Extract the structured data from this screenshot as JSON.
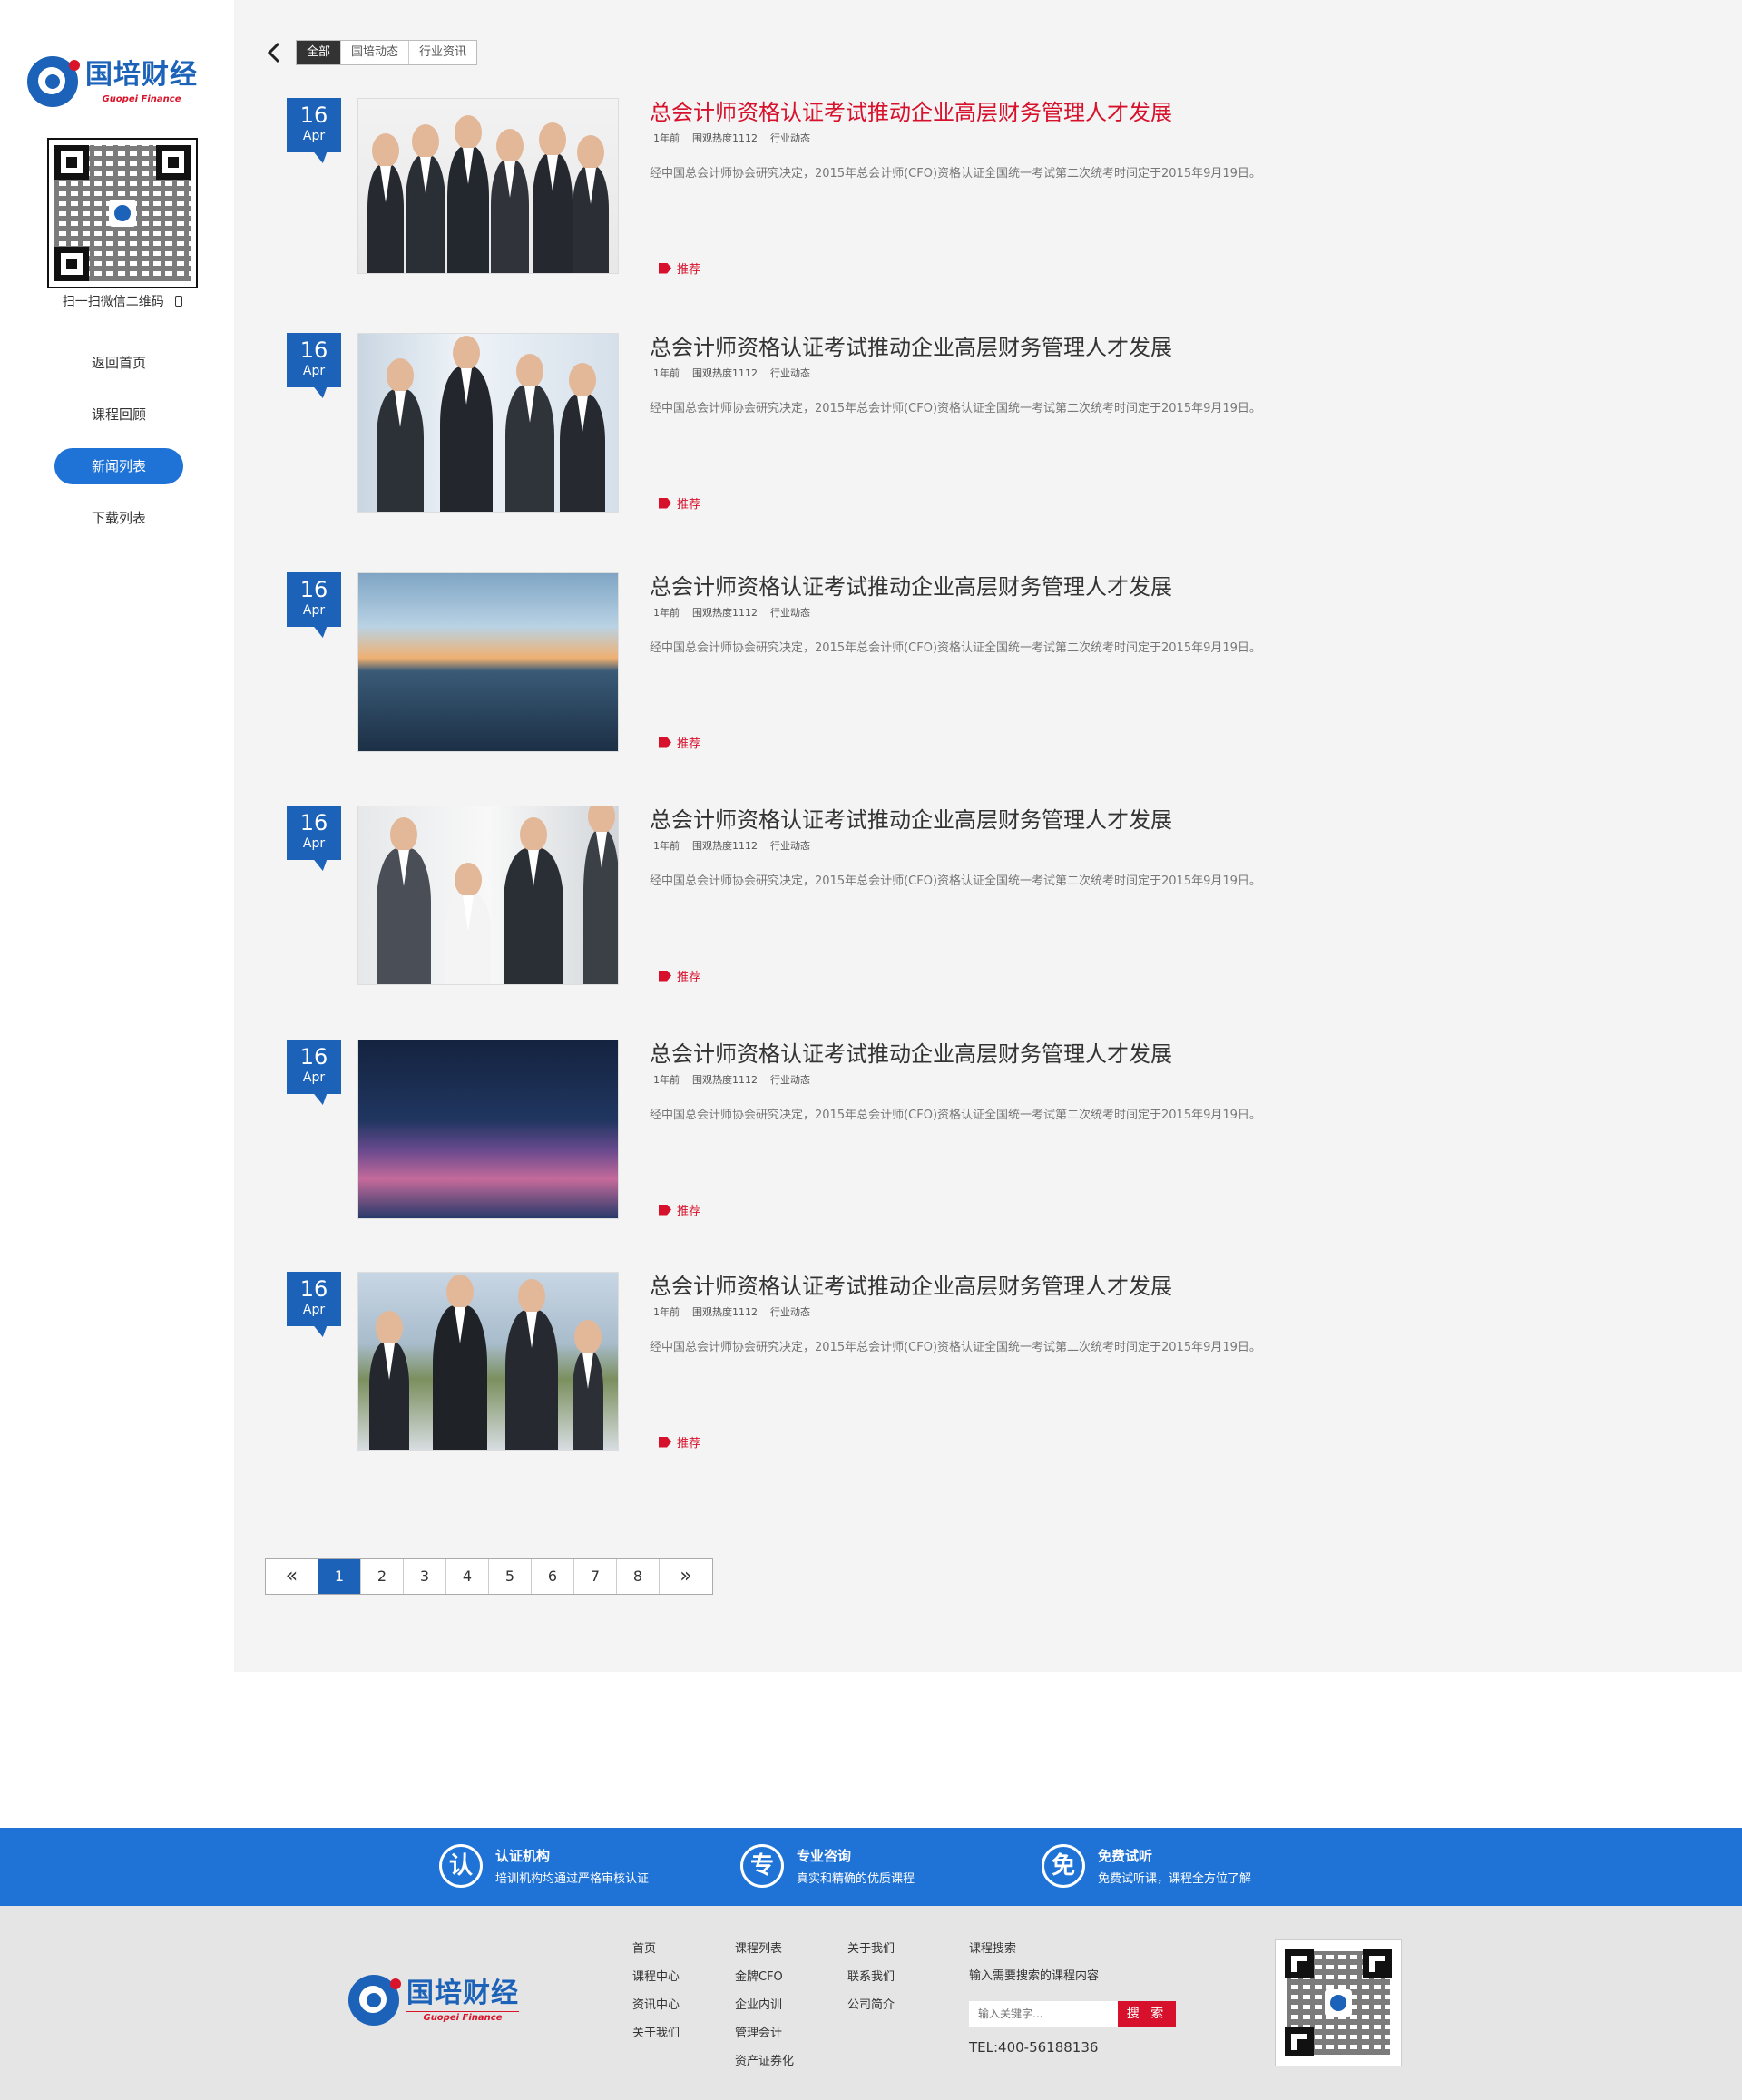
{
  "brand": {
    "name_cn": "国培财经",
    "name_en": "Guopei Finance"
  },
  "sidebar": {
    "qr_caption": "扫一扫微信二维码",
    "items": [
      {
        "label": "返回首页"
      },
      {
        "label": "课程回顾"
      },
      {
        "label": "新闻列表",
        "active": true
      },
      {
        "label": "下载列表"
      }
    ]
  },
  "filter": {
    "tabs": [
      "全部",
      "国培动态",
      "行业资讯"
    ],
    "active": "全部"
  },
  "articles": [
    {
      "day": "16",
      "month": "Apr",
      "title": "总会计师资格认证考试推动企业高层财务管理人才发展",
      "time": "1年前",
      "heat": "围观热度1112",
      "category": "行业动态",
      "desc": "经中国总会计师协会研究决定，2015年总会计师(CFO)资格认证全国统一考试第二次统考时间定于2015年9月19日。",
      "tag": "推荐"
    },
    {
      "day": "16",
      "month": "Apr",
      "title": "总会计师资格认证考试推动企业高层财务管理人才发展",
      "time": "1年前",
      "heat": "围观热度1112",
      "category": "行业动态",
      "desc": "经中国总会计师协会研究决定，2015年总会计师(CFO)资格认证全国统一考试第二次统考时间定于2015年9月19日。",
      "tag": "推荐"
    },
    {
      "day": "16",
      "month": "Apr",
      "title": "总会计师资格认证考试推动企业高层财务管理人才发展",
      "time": "1年前",
      "heat": "围观热度1112",
      "category": "行业动态",
      "desc": "经中国总会计师协会研究决定，2015年总会计师(CFO)资格认证全国统一考试第二次统考时间定于2015年9月19日。",
      "tag": "推荐"
    },
    {
      "day": "16",
      "month": "Apr",
      "title": "总会计师资格认证考试推动企业高层财务管理人才发展",
      "time": "1年前",
      "heat": "围观热度1112",
      "category": "行业动态",
      "desc": "经中国总会计师协会研究决定，2015年总会计师(CFO)资格认证全国统一考试第二次统考时间定于2015年9月19日。",
      "tag": "推荐"
    },
    {
      "day": "16",
      "month": "Apr",
      "title": "总会计师资格认证考试推动企业高层财务管理人才发展",
      "time": "1年前",
      "heat": "围观热度1112",
      "category": "行业动态",
      "desc": "经中国总会计师协会研究决定，2015年总会计师(CFO)资格认证全国统一考试第二次统考时间定于2015年9月19日。",
      "tag": "推荐"
    },
    {
      "day": "16",
      "month": "Apr",
      "title": "总会计师资格认证考试推动企业高层财务管理人才发展",
      "time": "1年前",
      "heat": "围观热度1112",
      "category": "行业动态",
      "desc": "经中国总会计师协会研究决定，2015年总会计师(CFO)资格认证全国统一考试第二次统考时间定于2015年9月19日。",
      "tag": "推荐"
    }
  ],
  "pagination": {
    "prev": "«",
    "pages": [
      "1",
      "2",
      "3",
      "4",
      "5",
      "6",
      "7",
      "8"
    ],
    "current": "1",
    "next": "»"
  },
  "features": [
    {
      "icon": "认",
      "title": "认证机构",
      "sub": "培训机构均通过严格审核认证"
    },
    {
      "icon": "专",
      "title": "专业咨询",
      "sub": "真实和精确的优质课程"
    },
    {
      "icon": "免",
      "title": "免费试听",
      "sub": "免费试听课，课程全方位了解"
    }
  ],
  "footer": {
    "col1": [
      "首页",
      "课程中心",
      "资讯中心",
      "关于我们"
    ],
    "col2": [
      "课程列表",
      "金牌CFO",
      "企业内训",
      "管理会计",
      "资产证券化"
    ],
    "col3": [
      "关于我们",
      "联系我们",
      "公司简介"
    ],
    "search_title": "课程搜索",
    "search_hint": "输入需要搜索的课程内容",
    "search_placeholder": "输入关键字...",
    "search_button": "搜 索",
    "tel": "TEL:400-56188136"
  },
  "colors": {
    "primary": "#1b62b8",
    "feature_bar": "#1f73d6",
    "accent_red": "#d7102b"
  }
}
